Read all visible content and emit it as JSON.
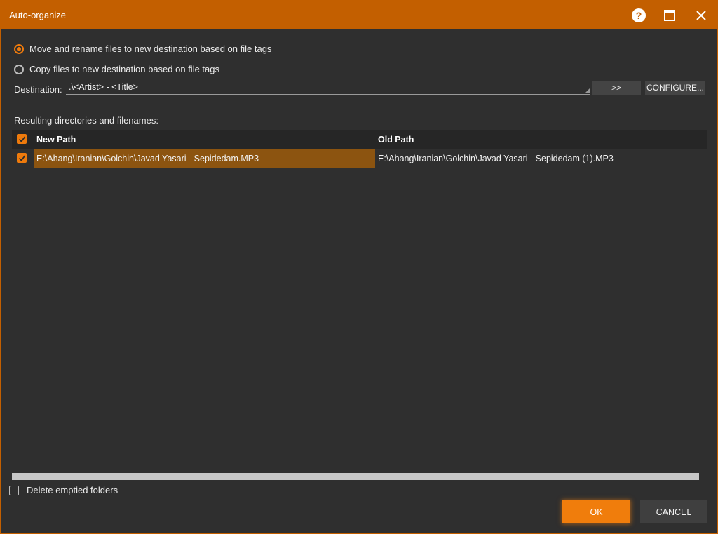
{
  "window": {
    "title": "Auto-organize",
    "accent": "#c35f00"
  },
  "titlebar": {
    "help_icon": "help-circle-icon",
    "maximize_icon": "maximize-icon",
    "close_icon": "close-icon"
  },
  "mode": {
    "options": [
      {
        "label": "Move and rename files to new destination based on file tags",
        "selected": true
      },
      {
        "label": "Copy files to new destination based on file tags",
        "selected": false
      }
    ]
  },
  "destination": {
    "label": "Destination:",
    "value": ".\\<Artist> - <Title>",
    "arrow_button": ">>",
    "configure_button": "CONFIGURE..."
  },
  "results": {
    "label": "Resulting directories and filenames:",
    "columns": [
      "New Path",
      "Old Path"
    ],
    "all_checked": true,
    "rows": [
      {
        "checked": true,
        "new_path": "E:\\Ahang\\Iranian\\Golchin\\Javad Yasari - Sepidedam.MP3",
        "old_path": "E:\\Ahang\\Iranian\\Golchin\\Javad Yasari - Sepidedam (1).MP3"
      }
    ]
  },
  "delete_emptied": {
    "label": "Delete emptied folders",
    "checked": false
  },
  "footer": {
    "ok": "OK",
    "cancel": "CANCEL"
  },
  "colors": {
    "highlight": "#f07d0c",
    "selection_row": "#8c5410"
  }
}
